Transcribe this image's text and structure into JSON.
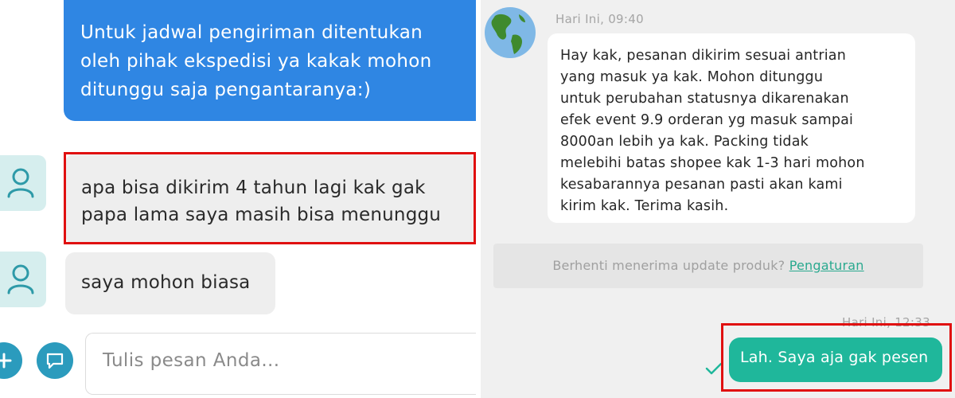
{
  "left_chat": {
    "messages": [
      {
        "sender": "seller",
        "lines": [
          "Untuk jadwal pengiriman ditentukan",
          "oleh pihak ekspedisi ya kakak mohon",
          "ditunggu saja pengantaranya:)"
        ]
      },
      {
        "sender": "buyer",
        "lines": [
          "apa bisa dikirim 4 tahun lagi kak gak",
          "papa lama saya masih bisa menunggu"
        ],
        "highlighted": true
      },
      {
        "sender": "buyer",
        "lines": [
          "saya mohon biasa"
        ]
      }
    ],
    "input": {
      "placeholder": "Tulis pesan Anda..."
    },
    "icons": {
      "avatar": "user-icon",
      "add": "plus-icon",
      "chat": "chat-bubble-icon"
    }
  },
  "right_chat": {
    "messages": [
      {
        "timestamp": "Hari Ini, 09:40",
        "lines": [
          "Hay kak, pesanan dikirim sesuai antrian",
          "yang masuk ya kak. Mohon ditunggu",
          "untuk perubahan statusnya dikarenakan",
          "efek event 9.9 orderan yg masuk sampai",
          "8000an lebih ya kak. Packing tidak",
          "melebihi batas shopee kak 1-3 hari mohon",
          "kesabarannya pesanan pasti akan kami",
          "kirim kak. Terima kasih."
        ]
      },
      {
        "timestamp": "Hari Ini, 12:33",
        "text": "Lah. Saya aja gak pesen",
        "highlighted": true
      }
    ],
    "notice": {
      "text": "Berhenti menerima update produk?",
      "link": "Pengaturan"
    },
    "icons": {
      "avatar": "globe-icon",
      "status": "check-icon"
    }
  },
  "colors": {
    "seller_bubble": "#2f86e3",
    "buyer_bubble": "#eeeeee",
    "sent_bubble": "#1fb79b",
    "highlight": "#e01010",
    "link": "#2aa98f",
    "accent_button": "#2b9bbd"
  }
}
